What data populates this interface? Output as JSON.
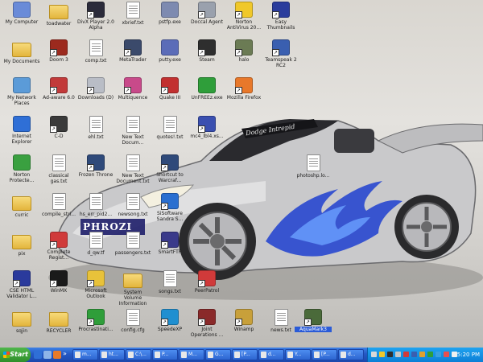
{
  "desktop": {
    "icons": [
      {
        "label": "My Computer",
        "glyph": "computer-icon",
        "color": "#6a8bd8",
        "type": "app",
        "shortcut": false
      },
      {
        "label": "toadwater",
        "glyph": "folder-icon",
        "color": "#e7c14f",
        "type": "folder",
        "shortcut": false
      },
      {
        "label": "DivX Player 2.0 Alpha",
        "glyph": "divx-icon",
        "color": "#2b2b3a",
        "type": "app",
        "shortcut": true
      },
      {
        "label": "xbrief.txt",
        "glyph": "text-file-icon",
        "color": "#ffffff",
        "type": "doc",
        "shortcut": false
      },
      {
        "label": "pstfp.exe",
        "glyph": "exe-icon",
        "color": "#7d8ab0",
        "type": "app",
        "shortcut": false
      },
      {
        "label": "Doccal Agent",
        "glyph": "agent-icon",
        "color": "#9aa1ad",
        "type": "app",
        "shortcut": true
      },
      {
        "label": "Norton AntiVirus 20...",
        "glyph": "norton-icon",
        "color": "#f0c82a",
        "type": "app",
        "shortcut": true
      },
      {
        "label": "Easy Thumbnails",
        "glyph": "thumbnails-icon",
        "color": "#2a3c9c",
        "type": "app",
        "shortcut": true
      },
      {
        "label": "My Documents",
        "glyph": "documents-folder-icon",
        "color": "#e7c14f",
        "type": "folder",
        "shortcut": false
      },
      {
        "label": "Doom 3",
        "glyph": "doom-icon",
        "color": "#9c2a1e",
        "type": "app",
        "shortcut": true
      },
      {
        "label": "comp.txt",
        "glyph": "text-file-icon",
        "color": "#ffffff",
        "type": "doc",
        "shortcut": false
      },
      {
        "label": "MetaTrader",
        "glyph": "metatrader-icon",
        "color": "#3b4a6b",
        "type": "app",
        "shortcut": true
      },
      {
        "label": "putty.exe",
        "glyph": "putty-icon",
        "color": "#5b6cb8",
        "type": "app",
        "shortcut": false
      },
      {
        "label": "Steam",
        "glyph": "steam-icon",
        "color": "#2e2e2e",
        "type": "app",
        "shortcut": true
      },
      {
        "label": "halo",
        "glyph": "halo-icon",
        "color": "#6b7b54",
        "type": "app",
        "shortcut": true
      },
      {
        "label": "Teamspeak 2 RC2",
        "glyph": "teamspeak-icon",
        "color": "#3a5fb0",
        "type": "app",
        "shortcut": true
      },
      {
        "label": "My Network Places",
        "glyph": "network-icon",
        "color": "#5b9bd8",
        "type": "app",
        "shortcut": false
      },
      {
        "label": "Ad-aware 6.0",
        "glyph": "adaware-icon",
        "color": "#c23a3a",
        "type": "app",
        "shortcut": true
      },
      {
        "label": "Downloads (D)",
        "glyph": "drive-icon",
        "color": "#b9bdc6",
        "type": "app",
        "shortcut": true
      },
      {
        "label": "Multiquence",
        "glyph": "multiquence-icon",
        "color": "#c84a8a",
        "type": "app",
        "shortcut": true
      },
      {
        "label": "Quake III",
        "glyph": "quake-icon",
        "color": "#c23030",
        "type": "app",
        "shortcut": true
      },
      {
        "label": "UnFREEz.exe",
        "glyph": "unfreez-icon",
        "color": "#2f9e3a",
        "type": "app",
        "shortcut": false
      },
      {
        "label": "Mozilla Firefox",
        "glyph": "firefox-icon",
        "color": "#e8782a",
        "type": "app",
        "shortcut": true
      },
      {
        "label": "Internet Explorer",
        "glyph": "ie-icon",
        "color": "#2f6fd6",
        "type": "app",
        "shortcut": false
      },
      {
        "label": "C-D",
        "glyph": "cd-icon",
        "color": "#3a3a3a",
        "type": "app",
        "shortcut": true
      },
      {
        "label": "ehl.txt",
        "glyph": "text-file-icon",
        "color": "#ffffff",
        "type": "doc",
        "shortcut": false
      },
      {
        "label": "New Text Docum...",
        "glyph": "text-file-icon",
        "color": "#ffffff",
        "type": "doc",
        "shortcut": false
      },
      {
        "label": "quotes!.txt",
        "glyph": "text-file-icon",
        "color": "#ffffff",
        "type": "doc",
        "shortcut": false
      },
      {
        "label": "mc4_lbl4.xs...",
        "glyph": "v2-icon",
        "color": "#3a4fb0",
        "type": "app",
        "shortcut": true
      },
      {
        "label": "Norton Protecte...",
        "glyph": "recycle-icon",
        "color": "#3aa040",
        "type": "app",
        "shortcut": false
      },
      {
        "label": "classical gas.txt",
        "glyph": "text-file-icon",
        "color": "#ffffff",
        "type": "doc",
        "shortcut": false
      },
      {
        "label": "Frozen Throne",
        "glyph": "warcraft-icon",
        "color": "#2f4a7a",
        "type": "app",
        "shortcut": true
      },
      {
        "label": "New Text Document.txt",
        "glyph": "text-file-icon",
        "color": "#ffffff",
        "type": "doc",
        "shortcut": false
      },
      {
        "label": "Shortcut to Warcraf...",
        "glyph": "warcraft-shortcut-icon",
        "color": "#2f4a7a",
        "type": "app",
        "shortcut": true
      },
      {
        "label": "photoshp.lo...",
        "glyph": "photoshop-file-icon",
        "color": "#ffffff",
        "type": "doc",
        "shortcut": false
      },
      {
        "label": "curric",
        "glyph": "folder-icon",
        "color": "#e7c14f",
        "type": "folder",
        "shortcut": false
      },
      {
        "label": "compile_stri...",
        "glyph": "text-file-icon",
        "color": "#ffffff",
        "type": "doc",
        "shortcut": false
      },
      {
        "label": "hs_err_pid2...",
        "glyph": "text-file-icon",
        "color": "#ffffff",
        "type": "doc",
        "shortcut": false
      },
      {
        "label": "newsong.txt",
        "glyph": "text-file-icon",
        "color": "#ffffff",
        "type": "doc",
        "shortcut": false
      },
      {
        "label": "SiSoftware Sandra S...",
        "glyph": "sandra-icon",
        "color": "#2a6fd0",
        "type": "app",
        "shortcut": true
      },
      {
        "label": "pix",
        "glyph": "folder-icon",
        "color": "#e7c14f",
        "type": "folder",
        "shortcut": false
      },
      {
        "label": "Complete Regist...",
        "glyph": "registry-icon",
        "color": "#d03a3a",
        "type": "app",
        "shortcut": true
      },
      {
        "label": "d_qw.tf",
        "glyph": "text-file-icon",
        "color": "#ffffff",
        "type": "doc",
        "shortcut": false
      },
      {
        "label": "passengers.txt",
        "glyph": "text-file-icon",
        "color": "#ffffff",
        "type": "doc",
        "shortcut": false
      },
      {
        "label": "SmartFTP",
        "glyph": "smartftp-icon",
        "color": "#3a3a8a",
        "type": "app",
        "shortcut": true
      },
      {
        "label": "CSE HTML Validator L...",
        "glyph": "html-validator-icon",
        "color": "#2a3a9c",
        "type": "app",
        "shortcut": true
      },
      {
        "label": "WinMX",
        "glyph": "winmx-icon",
        "color": "#1a1a1a",
        "type": "app",
        "shortcut": true
      },
      {
        "label": "Microsoft Outlook",
        "glyph": "outlook-icon",
        "color": "#e8c23a",
        "type": "app",
        "shortcut": true
      },
      {
        "label": "System Volume Information",
        "glyph": "folder-icon",
        "color": "#e7c14f",
        "type": "folder",
        "shortcut": false
      },
      {
        "label": "songs.txt",
        "glyph": "text-file-icon",
        "color": "#ffffff",
        "type": "doc",
        "shortcut": false
      },
      {
        "label": "PeerPatrol",
        "glyph": "peerpatrol-icon",
        "color": "#d03a3a",
        "type": "app",
        "shortcut": true
      },
      {
        "label": "sqjin",
        "glyph": "folder-icon",
        "color": "#e7c14f",
        "type": "folder",
        "shortcut": false
      },
      {
        "label": "RECYCLER",
        "glyph": "folder-icon",
        "color": "#e7c14f",
        "type": "folder",
        "shortcut": false
      },
      {
        "label": "Procrastinati...",
        "glyph": "procrastination-icon",
        "color": "#2f9e3a",
        "type": "app",
        "shortcut": true
      },
      {
        "label": "config.cfg",
        "glyph": "config-file-icon",
        "color": "#ffffff",
        "type": "doc",
        "shortcut": false
      },
      {
        "label": "SpeedeXP",
        "glyph": "speedexp-icon",
        "color": "#1f8fd0",
        "type": "app",
        "shortcut": true
      },
      {
        "label": "Joint Operations ...",
        "glyph": "joint-ops-icon",
        "color": "#8a2a2a",
        "type": "app",
        "shortcut": true
      },
      {
        "label": "Winamp",
        "glyph": "winamp-icon",
        "color": "#c8a03a",
        "type": "app",
        "shortcut": true
      },
      {
        "label": "news.txt",
        "glyph": "text-file-icon",
        "color": "#ffffff",
        "type": "doc",
        "shortcut": false
      },
      {
        "label": "AquaMark3",
        "glyph": "aquamark-icon",
        "color": "#4a6a3a",
        "type": "app",
        "shortcut": true,
        "selected": true
      }
    ],
    "wallpaper_text": [
      "PHROZI",
      "Dodge Intrepid"
    ]
  },
  "taskbar": {
    "start_label": "Start",
    "tasks": [
      {
        "label": "m..."
      },
      {
        "label": "ht..."
      },
      {
        "label": "C:\\..."
      },
      {
        "label": "P..."
      },
      {
        "label": "M..."
      },
      {
        "label": "G..."
      },
      {
        "label": "[P..."
      },
      {
        "label": "d..."
      },
      {
        "label": "Y..."
      },
      {
        "label": "[P..."
      },
      {
        "label": "d..."
      }
    ],
    "clock": "5:20 PM"
  },
  "colors": {
    "taskbar": "#2458c4",
    "tray": "#0c7fd6",
    "start": "#2f8f2b"
  }
}
